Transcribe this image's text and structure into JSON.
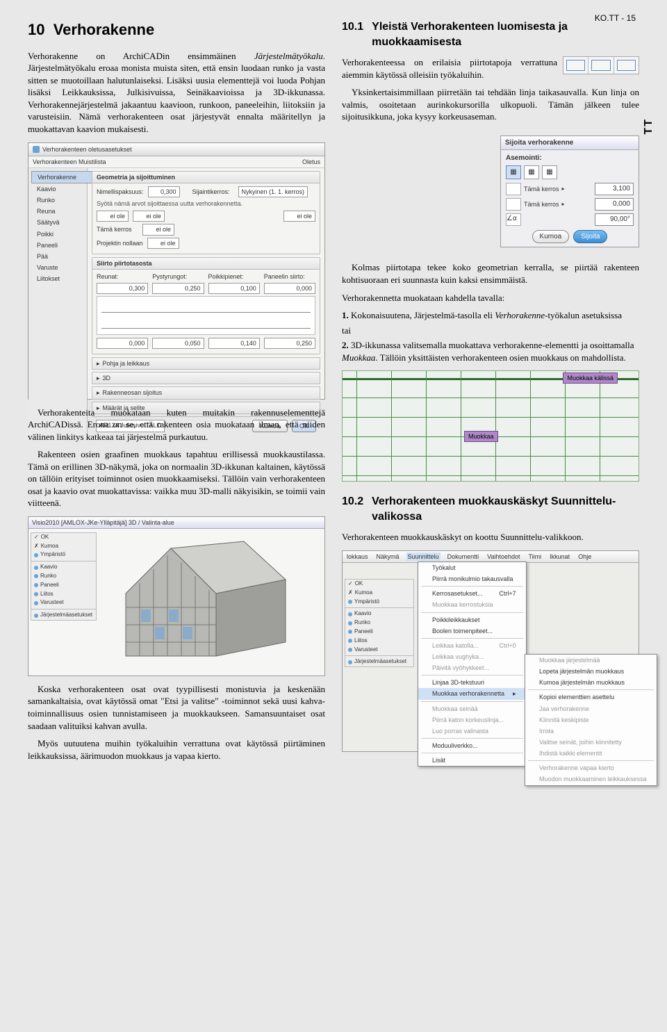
{
  "page_code": "KO.TT - 15",
  "side_tab": "TT",
  "chapter": {
    "num": "10",
    "title": "Verhorakenne"
  },
  "intro": {
    "p1a": "Verhorakenne on ArchiCADin ensimmäinen ",
    "p1b": "Järjestelmätyökalu",
    "p1c": ". Järjestelmätyökalu eroaa monista muista siten, että ensin luodaan runko ja vasta sitten se muotoillaan halutunlaiseksi. Lisäksi uusia elementtejä voi luoda Pohjan lisäksi Leikkauksissa, Julkisivuissa, Seinäkaavioissa ja 3D-ikkunassa. Verhorakennejärjestelmä jakaantuu kaavioon, runkoon, paneeleihin, liitoksiin ja varusteisiin. Nämä verhorakenteen osat järjestyvät ennalta määritellyn ja muokattavan kaavion mukaisesti."
  },
  "ss1": {
    "title": "Verhorakenteen oletusasetukset",
    "topbar_left": "Verhorakenteen Muistilista",
    "topbar_right": "Oletus",
    "side_items": [
      "Verhorakenne",
      "Kaavio",
      "Runko",
      "Reuna",
      "Säätyvä",
      "Poikki",
      "Paneeli",
      "Pää",
      "Varuste",
      "Liitokset"
    ],
    "panel1": "Geometria ja sijoittuminen",
    "lbl_nimellis": "Nimellispaksuus:",
    "val_nimellis": "0,300",
    "lbl_sijainti": "Sijaintikerros:",
    "val_sijainti": "Nykyinen (1. 1. kerros)",
    "note": "Syötä nämä arvot sijoittaessa uutta verhorakennetta.",
    "chips": [
      "ei ole",
      "ei ole",
      "ei ole",
      "Tämä kerros",
      "ei ole",
      "Projektin nollaan",
      "ei ole"
    ],
    "panel2": "Siirto piirtotasosta",
    "hdr": [
      "Reunat:",
      "Pystyrungot:",
      "Poikkipienet:",
      "Paneelin siirto:"
    ],
    "vals": [
      "0,300",
      "0,250",
      "0,100",
      "0,000"
    ],
    "vals2": [
      "0,000",
      "0,050",
      "0,140",
      "0,250"
    ],
    "collapsed": [
      "Pohja ja leikkaus",
      "3D",
      "Rakenneosan sijoitus",
      "Määrät ja selite"
    ],
    "layer": "AR124 Julkisivu.TALO",
    "btn_cancel": "Kumoa",
    "btn_ok": "OK"
  },
  "after_ss1": {
    "p1": "Verhorakenteita muokataan kuten muitakin rakennuselementtejä ArchiCADissä. Erona on se, että rakenteen osia muokataan ilman, että niiden välinen linkitys katkeaa tai järjestelmä purkautuu.",
    "p2": "Rakenteen osien graafinen muokkaus tapahtuu erillisessä muokkaustilassa. Tämä on erillinen 3D-näkymä, joka on normaalin 3D-ikkunan kaltainen, käytössä on tällöin erityiset toiminnot osien muokkaamiseksi. Tällöin vain verhorakenteen osat ja kaavio ovat muokattavissa: vaikka muu 3D-malli näkyisikin, se toimii vain viitteenä."
  },
  "ss4": {
    "title": "Visio2010 [AMLOX-JKe-Ylläpitäjä] 3D / Valinta-alue",
    "side": [
      "OK",
      "Kumoa",
      "Ympäristö",
      "Kaavio",
      "Runko",
      "Paneeli",
      "Liitos",
      "Varusteet",
      "Järjestelmäasetukset"
    ]
  },
  "sec101": {
    "num": "10.1",
    "title": "Yleistä Verhorakenteen luomisesta ja muokkaamisesta",
    "p1": "Verhorakenteessa on erilaisia piirtotapoja verrattuna aiemmin käytössä olleisiin työkaluihin.",
    "p2": "Yksinkertaisimmillaan piirretään tai tehdään linja taikasauvalla. Kun linja on valmis, osoitetaan aurinkokursorilla ulkopuoli. Tämän jälkeen tulee sijoitusikkuna, joka kysyy korkeusaseman."
  },
  "ss2": {
    "title": "Sijoita verhorakenne",
    "asemointi": "Asemointi:",
    "rows": [
      {
        "t": "Tämä kerros",
        "v": "3,100"
      },
      {
        "t": "Tämä kerros",
        "v": "0,000"
      },
      {
        "t": "",
        "v": "90,00°"
      }
    ],
    "btn_cancel": "Kumoa",
    "btn_ok": "Sijoita"
  },
  "after_ss2": {
    "p1": "Kolmas piirtotapa tekee koko geometrian kerralla, se piirtää rakenteen kohtisuoraan eri suunnasta kuin kaksi ensimmäistä.",
    "p2": "Verhorakennetta muokataan kahdella tavalla:",
    "li1_n": "1.",
    "li1": "Kokonaisuutena, Järjestelmä-tasolla eli ",
    "li1_i": "Verhorakenne",
    "li1b": "-työkalun asetuksissa",
    "tai": "tai",
    "li2_n": "2.",
    "li2": "3D-ikkunassa valitsemalla muokattava verhorakenne-elementti ja osoittamalla ",
    "li2_i": "Muokkaa",
    "li2b": ". Tällöin yksittäisten verhorakenteen osien muokkaus on mahdollista."
  },
  "ss3": {
    "tag1": "Muokkaa kälissä",
    "tag2": "Muokkaa"
  },
  "sec102": {
    "num": "10.2",
    "title": "Verhorakenteen muokkauskäskyt Suunnittelu-valikossa",
    "p1": "Verhorakenteen muokkauskäskyt on koottu Suunnittelu-valikkoon."
  },
  "ss5": {
    "menus": [
      "lokkaus",
      "Näkymä",
      "Suunnittelu",
      "Dokumentti",
      "Vaihtoehdot",
      "Tiimi",
      "Ikkunat",
      "Ohje"
    ],
    "side": [
      "OK",
      "Kumoa",
      "Ympäristö",
      "Kaavio",
      "Runko",
      "Paneeli",
      "Liitos",
      "Varusteet",
      "Järjestelmäasetukset"
    ],
    "menu1": [
      "Työkalut",
      "Piirrä monikulmio takausvalla",
      "sep",
      {
        "t": "Kerrosasetukset...",
        "k": "Ctrl+7"
      },
      {
        "t": "Muokkaa kerrostuksia",
        "dim": true
      },
      "sep",
      "Poikkileikkaukset",
      "Boolen toimenpiteet...",
      "sep",
      {
        "t": "Leikkaa katolla...",
        "k": "Ctrl+0",
        "dim": true
      },
      {
        "t": "Leikkaa vughyka...",
        "dim": true
      },
      {
        "t": "Päivitä vyöhykkeet...",
        "dim": true
      },
      "sep",
      "Linjaa 3D-tekstuuri",
      {
        "t": "Muokkaa verhorakennetta",
        "sel": true,
        "arrow": true
      },
      "sep",
      {
        "t": "Muokkaa seinää",
        "dim": true
      },
      {
        "t": "Piirrä katon korkeuslinja...",
        "dim": true
      },
      {
        "t": "Luo porras valinasta",
        "dim": true
      },
      "sep",
      "Moduuliverkko...",
      "sep",
      "Lisät"
    ],
    "menu2": [
      {
        "t": "Muokkaa järjestelmää",
        "dim": true
      },
      "Lopeta järjestelmän muokkaus",
      "Kumoa järjestelmän muokkaus",
      "sep",
      "Kopioi elementtien asettelu",
      {
        "t": "Jaa verhorakenne",
        "dim": true
      },
      {
        "t": "Kiinnitä keskipiste",
        "dim": true
      },
      {
        "t": "Irrota",
        "dim": true
      },
      {
        "t": "Valitse seinät, joihin kiinnitetty",
        "dim": true
      },
      {
        "t": "Ihdistä kaikki elementit",
        "dim": true
      },
      "sep",
      {
        "t": "Verhorakenne vapaa kierto",
        "dim": true
      },
      {
        "t": "Muodon muokkaaminen leikkauksessa",
        "dim": true
      }
    ]
  },
  "bottom": {
    "p1": "Koska verhorakenteen osat ovat tyypillisesti monistuvia ja keskenään samankaltaisia, ovat käytössä omat \"Etsi ja valitse\" -toiminnot sekä uusi kahva-toiminnallisuus osien tunnistamiseen ja muokkaukseen. Samansuuntaiset osat saadaan valituiksi kahvan avulla.",
    "p2": "Myös uutuutena muihin työkaluihin verrattuna ovat käytössä piirtäminen leikkauksissa, äärimuodon muokkaus ja vapaa kierto."
  }
}
